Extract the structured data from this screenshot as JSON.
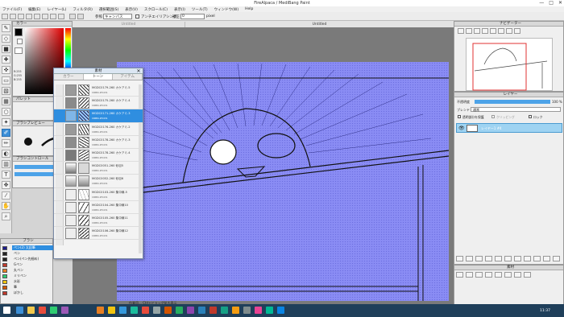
{
  "app": {
    "title": "FireAlpaca / MediBang Paint"
  },
  "menu": [
    "ファイル(F)",
    "編集(E)",
    "レイヤー(L)",
    "フィルタ(R)",
    "選択範囲(S)",
    "表示(V)",
    "スクロール(C)",
    "表示(I)",
    "ツール(T)",
    "ウィンドウ(W)",
    "Help"
  ],
  "toolbar": {
    "brush_label": "参照",
    "brush_value": "キャンバス",
    "aa_label": "アンチエイリアシング",
    "aa2_label": "補正",
    "value": "0",
    "unit": "pixel"
  },
  "doc_tabs": [
    "Untitled",
    "Untitled"
  ],
  "panels": {
    "color": "カラー",
    "palette": "パレット",
    "brush_preview": "ブラシプレビュー",
    "brush_control": "ブラシコントロール",
    "brush": "ブラシ",
    "navigator": "ナビゲーター",
    "layer": "レイヤー",
    "material": "素材"
  },
  "color_values": {
    "r": "R:255",
    "g": "G:255",
    "b": "B:255"
  },
  "brush_list": [
    {
      "name": "ペン(2) 太鉛筆",
      "color": "#1c1c8c"
    },
    {
      "name": "ペン",
      "color": "#222222"
    },
    {
      "name": "ペン(ペン先細め)",
      "color": "#222222"
    },
    {
      "name": "Gペン",
      "color": "#c0392b"
    },
    {
      "name": "丸ペン",
      "color": "#e67e22"
    },
    {
      "name": "ミリペン",
      "color": "#2ecc71"
    },
    {
      "name": "水彩",
      "color": "#f1c40f"
    },
    {
      "name": "筆",
      "color": "#d35400"
    },
    {
      "name": "ぼかし",
      "color": "#c0392b"
    }
  ],
  "dialog": {
    "title": "素材",
    "tabs": [
      "カラー",
      "トーン",
      "アイテム"
    ],
    "active_tab": 1,
    "tones": [
      {
        "name": "MGDC0179-260 カケアミ-5",
        "sub": "CRBN-#5431",
        "selected": false
      },
      {
        "name": "MGDC0175-260 カケアミ-4",
        "sub": "CRBN-#5431",
        "selected": false
      },
      {
        "name": "MGDC0171-260 カケアミ-3",
        "sub": "CRBN-#5431",
        "selected": true
      },
      {
        "name": "MGDC0176-260 カケアミ-2",
        "sub": "CRBN-#5431",
        "selected": false
      },
      {
        "name": "MGDC0178-260 カケアミ-3",
        "sub": "CRBN-#5431",
        "selected": false
      },
      {
        "name": "MGDC0178-260 カケアミ-4",
        "sub": "CRBN-#5431",
        "selected": false
      },
      {
        "name": "MGDC0051-260 砂目5",
        "sub": "CRBN-#5431",
        "selected": false
      },
      {
        "name": "MGDC0052-260 砂目6",
        "sub": "CRBN-#5431",
        "selected": false
      },
      {
        "name": "MGDC0103-260 集中線-5",
        "sub": "CRBN-#5431",
        "selected": false
      },
      {
        "name": "MGDC0104-260 集中線10",
        "sub": "CRBN-#5431",
        "selected": false
      },
      {
        "name": "MGDC0105-260 集中線11",
        "sub": "CRBN-#5431",
        "selected": false
      },
      {
        "name": "MGDC0106-260 集中線12",
        "sub": "CRBN-#5431",
        "selected": false
      }
    ]
  },
  "layer": {
    "opacity_label": "不透明度",
    "opacity_value": "100 %",
    "blend_label": "ブレンド",
    "blend_value": "通常",
    "protect_label": "透明部分を保護",
    "clip_label": "クリッピング",
    "lock_label": "ロック",
    "layer_name": "レイヤー1 #4"
  },
  "status": {
    "size": "1920 * 1080 pixel  (31.6 * 8.1",
    "hint": "作業用... Ctrl+ドラッグ拡大表示",
    "time": "11:37"
  },
  "colors": {
    "accent": "#2f8ee0",
    "paper": "#8a8cf4",
    "taskbar": "#1f3f5a"
  }
}
